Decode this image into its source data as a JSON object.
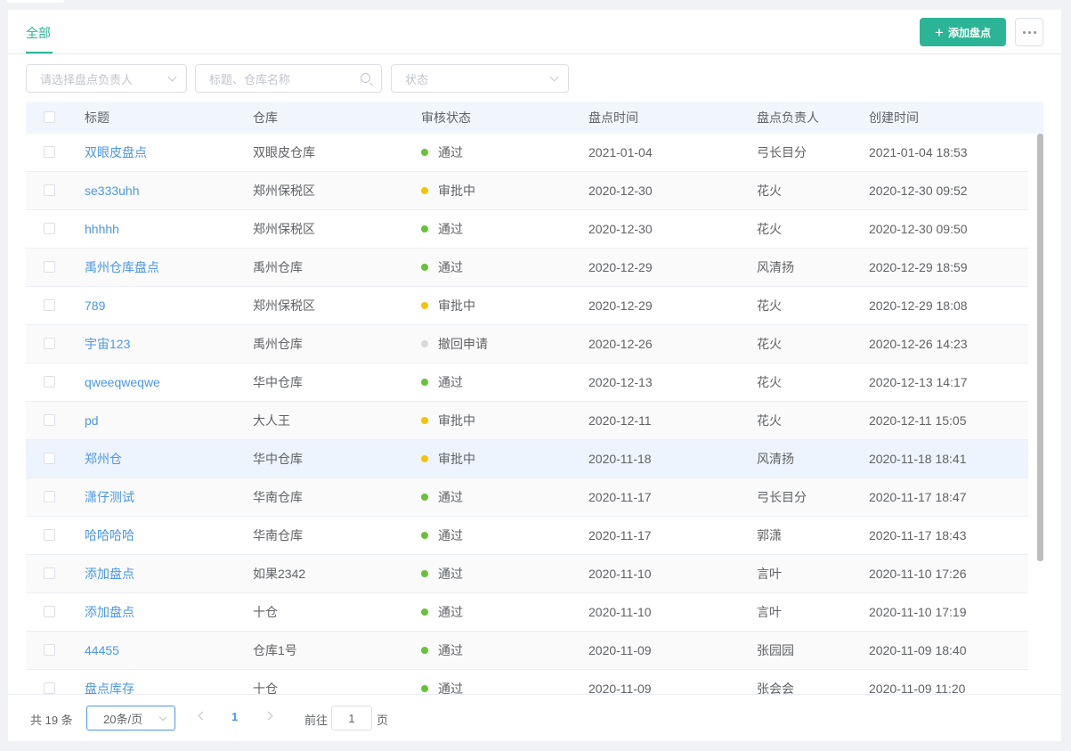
{
  "tabs": {
    "all_label": "全部"
  },
  "toolbar": {
    "add_label": "添加盘点",
    "add_icon": "plus-icon",
    "more_icon": "more-dots-icon"
  },
  "filters": {
    "owner_placeholder": "请选择盘点负责人",
    "keyword_placeholder": "标题、仓库名称",
    "status_placeholder": "状态"
  },
  "colors": {
    "accent": "#2bb596",
    "link": "#4c97e6",
    "status_pass": "#67c23a",
    "status_pending": "#f5c400",
    "status_withdrawn": "#d9d9d9"
  },
  "table": {
    "columns": [
      "标题",
      "仓库",
      "审核状态",
      "盘点时间",
      "盘点负责人",
      "创建时间"
    ],
    "rows": [
      {
        "title": "双眼皮盘点",
        "warehouse": "双眼皮仓库",
        "status": "通过",
        "status_type": "pass",
        "check_date": "2021-01-04",
        "owner": "弓长目分",
        "created": "2021-01-04 18:53"
      },
      {
        "title": "se333uhh",
        "warehouse": "郑州保税区",
        "status": "审批中",
        "status_type": "pending",
        "check_date": "2020-12-30",
        "owner": "花火",
        "created": "2020-12-30 09:52"
      },
      {
        "title": "hhhhh",
        "warehouse": "郑州保税区",
        "status": "通过",
        "status_type": "pass",
        "check_date": "2020-12-30",
        "owner": "花火",
        "created": "2020-12-30 09:50"
      },
      {
        "title": "禹州仓库盘点",
        "warehouse": "禹州仓库",
        "status": "通过",
        "status_type": "pass",
        "check_date": "2020-12-29",
        "owner": "风清扬",
        "created": "2020-12-29 18:59"
      },
      {
        "title": "789",
        "warehouse": "郑州保税区",
        "status": "审批中",
        "status_type": "pending",
        "check_date": "2020-12-29",
        "owner": "花火",
        "created": "2020-12-29 18:08"
      },
      {
        "title": "宇宙123",
        "warehouse": "禹州仓库",
        "status": "撤回申请",
        "status_type": "withdrawn",
        "check_date": "2020-12-26",
        "owner": "花火",
        "created": "2020-12-26 14:23"
      },
      {
        "title": "qweeqweqwe",
        "warehouse": "华中仓库",
        "status": "通过",
        "status_type": "pass",
        "check_date": "2020-12-13",
        "owner": "花火",
        "created": "2020-12-13 14:17"
      },
      {
        "title": "pd",
        "warehouse": "大人王",
        "status": "审批中",
        "status_type": "pending",
        "check_date": "2020-12-11",
        "owner": "花火",
        "created": "2020-12-11 15:05"
      },
      {
        "title": "郑州仓",
        "warehouse": "华中仓库",
        "status": "审批中",
        "status_type": "pending",
        "check_date": "2020-11-18",
        "owner": "风清扬",
        "created": "2020-11-18 18:41"
      },
      {
        "title": "潇仔测试",
        "warehouse": "华南仓库",
        "status": "通过",
        "status_type": "pass",
        "check_date": "2020-11-17",
        "owner": "弓长目分",
        "created": "2020-11-17 18:47"
      },
      {
        "title": "哈哈哈哈",
        "warehouse": "华南仓库",
        "status": "通过",
        "status_type": "pass",
        "check_date": "2020-11-17",
        "owner": "郭潇",
        "created": "2020-11-17 18:43"
      },
      {
        "title": "添加盘点",
        "warehouse": "如果2342",
        "status": "通过",
        "status_type": "pass",
        "check_date": "2020-11-10",
        "owner": "言叶",
        "created": "2020-11-10 17:26"
      },
      {
        "title": "添加盘点",
        "warehouse": "十仓",
        "status": "通过",
        "status_type": "pass",
        "check_date": "2020-11-10",
        "owner": "言叶",
        "created": "2020-11-10 17:19"
      },
      {
        "title": "44455",
        "warehouse": "仓库1号",
        "status": "通过",
        "status_type": "pass",
        "check_date": "2020-11-09",
        "owner": "张园园",
        "created": "2020-11-09 18:40"
      },
      {
        "title": "盘点库存",
        "warehouse": "十仓",
        "status": "通过",
        "status_type": "pass",
        "check_date": "2020-11-09",
        "owner": "张会会",
        "created": "2020-11-09 11:20"
      }
    ],
    "highlighted_row": 8
  },
  "pagination": {
    "total_text": "共 19 条",
    "page_size": "20条/页",
    "current_page": "1",
    "goto_label": "前往",
    "goto_value": "1",
    "goto_suffix": "页"
  }
}
